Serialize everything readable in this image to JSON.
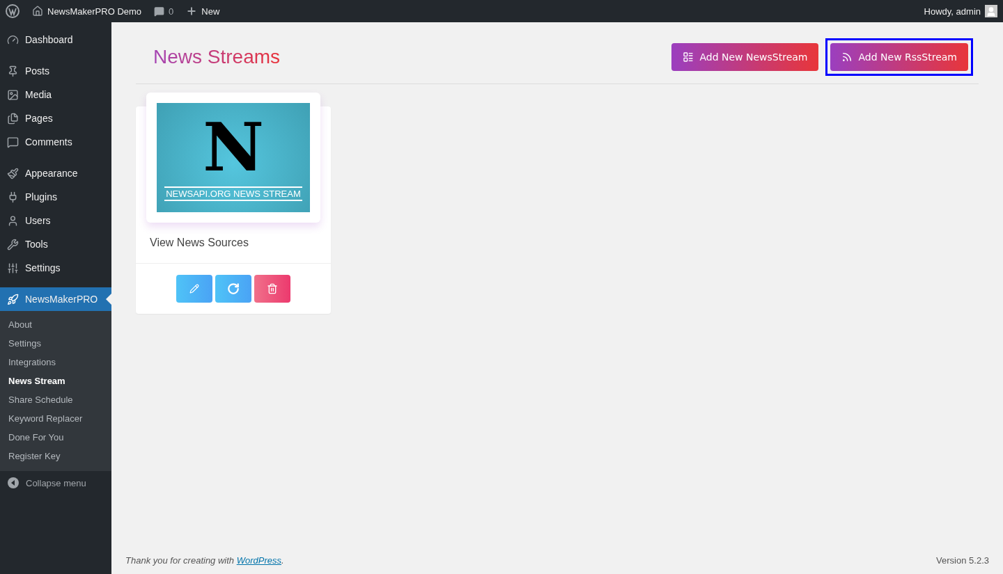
{
  "admin_bar": {
    "site_name": "NewsMakerPRO Demo",
    "comments_count": "0",
    "new_label": "New",
    "greeting": "Howdy, admin"
  },
  "sidebar": {
    "items": [
      {
        "label": "Dashboard",
        "selected": false
      },
      {
        "label": "Posts",
        "selected": false
      },
      {
        "label": "Media",
        "selected": false
      },
      {
        "label": "Pages",
        "selected": false
      },
      {
        "label": "Comments",
        "selected": false
      },
      {
        "label": "Appearance",
        "selected": false
      },
      {
        "label": "Plugins",
        "selected": false
      },
      {
        "label": "Users",
        "selected": false
      },
      {
        "label": "Tools",
        "selected": false
      },
      {
        "label": "Settings",
        "selected": false
      },
      {
        "label": "NewsMakerPRO",
        "selected": true
      }
    ],
    "submenu": [
      {
        "label": "About",
        "selected": false
      },
      {
        "label": "Settings",
        "selected": false
      },
      {
        "label": "Integrations",
        "selected": false
      },
      {
        "label": "News Stream",
        "selected": true
      },
      {
        "label": "Share Schedule",
        "selected": false
      },
      {
        "label": "Keyword Replacer",
        "selected": false
      },
      {
        "label": "Done For You",
        "selected": false
      },
      {
        "label": "Register Key",
        "selected": false
      }
    ],
    "collapse_label": "Collapse menu"
  },
  "page": {
    "title": "News Streams",
    "buttons": [
      {
        "label": "Add New NewsStream",
        "kind": "news",
        "focused": false
      },
      {
        "label": "Add New RssStream",
        "kind": "rss",
        "focused": true
      }
    ]
  },
  "streams": [
    {
      "image_letter": "N",
      "image_caption": "NEWSAPI.ORG NEWS STREAM",
      "link": "View News Sources"
    }
  ],
  "footer": {
    "thanks_prefix": "Thank you for creating with ",
    "thanks_link": "WordPress",
    "thanks_suffix": ".",
    "version": "Version 5.2.3"
  }
}
